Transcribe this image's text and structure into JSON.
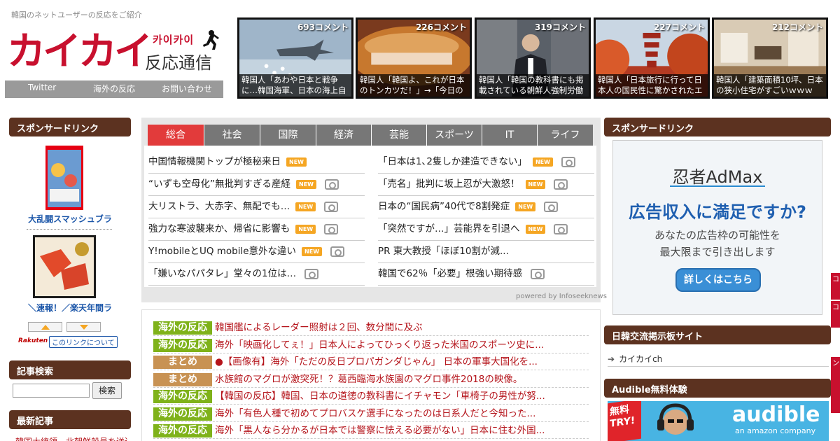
{
  "header": {
    "tagline": "韓国のネットユーザーの反応をご紹介",
    "logo_main": "カイカイ",
    "logo_small": "카이카이",
    "logo_sub": "反応通信",
    "nav": [
      "Twitter",
      "海外の反応",
      "お問い合わせ"
    ]
  },
  "thumbs": [
    {
      "count": "693コメント",
      "caption": "韓国人「あわや日本と戦争に…韓国海軍、日本の海上自"
    },
    {
      "count": "226コメント",
      "caption": "韓国人「韓国よ、これが日本のトンカツだ！」→「今日の"
    },
    {
      "count": "319コメント",
      "caption": "韓国人「韓国の教科書にも掲載されている朝鮮人強制労働"
    },
    {
      "count": "227コメント",
      "caption": "韓国人「日本旅行に行って日本人の国民性に驚かされたエ"
    },
    {
      "count": "212コメント",
      "caption": "韓国人「建築面積10坪、日本の狭小住宅がすごいｗｗｗ"
    }
  ],
  "left": {
    "sponsor_title": "スポンサードリンク",
    "ad1_caption": "大乱闘スマッシュブラ",
    "ad2_caption": "＼速報！／楽天年間ラ",
    "rakuten": "Rakuten",
    "about_link": "このリンクについて",
    "search_title": "記事検索",
    "search_button": "検索",
    "latest_title": "最新記事",
    "latest_first": "韓国大統領、北朝鮮船員を送還..."
  },
  "news": {
    "tabs": [
      "総合",
      "社会",
      "国際",
      "経済",
      "芸能",
      "スポーツ",
      "IT",
      "ライフ"
    ],
    "new_label": "NEW",
    "left_items": [
      {
        "text": "中国情報機関トップが極秘来日",
        "new": true,
        "cam": false
      },
      {
        "text": "“いずも空母化”無批判すぎる産経",
        "new": true,
        "cam": true
      },
      {
        "text": "大リストラ、大赤字、無配でも…",
        "new": true,
        "cam": true
      },
      {
        "text": "強力な寒波襲来か、帰省に影響も",
        "new": true,
        "cam": true
      },
      {
        "text": "Y!mobileとUQ mobile意外な違い",
        "new": true,
        "cam": true
      },
      {
        "text": "「嫌いなパパタレ」堂々の1位は…",
        "new": false,
        "cam": true
      }
    ],
    "right_items": [
      {
        "text": "「日本は1､2隻しか建造できない」",
        "new": true,
        "cam": true
      },
      {
        "text": "「売名」批判に坂上忍が大激怒！",
        "new": true,
        "cam": true
      },
      {
        "text": "日本の“国民病”40代で8割発症",
        "new": true,
        "cam": true
      },
      {
        "text": "「突然ですが…」芸能界を引退へ",
        "new": true,
        "cam": true
      },
      {
        "text": "PR 東大教授「ほぼ10割が減...",
        "new": false,
        "cam": false
      },
      {
        "text": "韓国で62％「必要」根強い期待感",
        "new": false,
        "cam": true
      }
    ],
    "powered": "powered by Infoseeknews"
  },
  "feed": [
    {
      "tag": "海外の反応",
      "color": "#7fb21a",
      "text": "韓国艦によるレーダー照射は２回、数分間に及ぶ"
    },
    {
      "tag": "海外の反応",
      "color": "#7fb21a",
      "text": "海外「映画化してぇ！」日本人によってひっくり返った米国のスポーツ史に..."
    },
    {
      "tag": "まとめ",
      "color": "#c89253",
      "text": "●【画像有】海外「ただの反日プロパガンダじゃん」 日本の軍事大国化を..."
    },
    {
      "tag": "まとめ",
      "color": "#c89253",
      "text": "水族館のマグロが激突死！？葛西臨海水族園のマグロ事件2018の映像。"
    },
    {
      "tag": "海外の反応",
      "color": "#7fb21a",
      "text": "【韓国の反応】韓国、日本の道徳の教科書にイチャモン「車椅子の男性が努..."
    },
    {
      "tag": "海外の反応",
      "color": "#7fb21a",
      "text": "海外「有色人種で初めてプロバスケ選手になったのは日系人だと今知った..."
    },
    {
      "tag": "海外の反応",
      "color": "#7fb21a",
      "text": "海外「黒人なら分かるが日本では警察に怯える必要がない」日本に住む外国..."
    }
  ],
  "right": {
    "sponsor_title": "スポンサードリンク",
    "admax_logo": "忍者AdMax",
    "admax_head": "広告収入に満足ですか?",
    "admax_sub1": "あなたの広告枠の可能性を",
    "admax_sub2": "最大限まで引き出します",
    "admax_btn": "詳しくはこちら",
    "board_title": "日韓交流掲示板サイト",
    "board_link": "カイカイch",
    "audible_title": "Audible無料体験",
    "audible_badge1": "無料",
    "audible_badge2": "TRY!",
    "audible_logo": "audible",
    "audible_sub": "an amazon company"
  },
  "sidetabs": [
    "コ",
    "コ",
    "ン"
  ]
}
